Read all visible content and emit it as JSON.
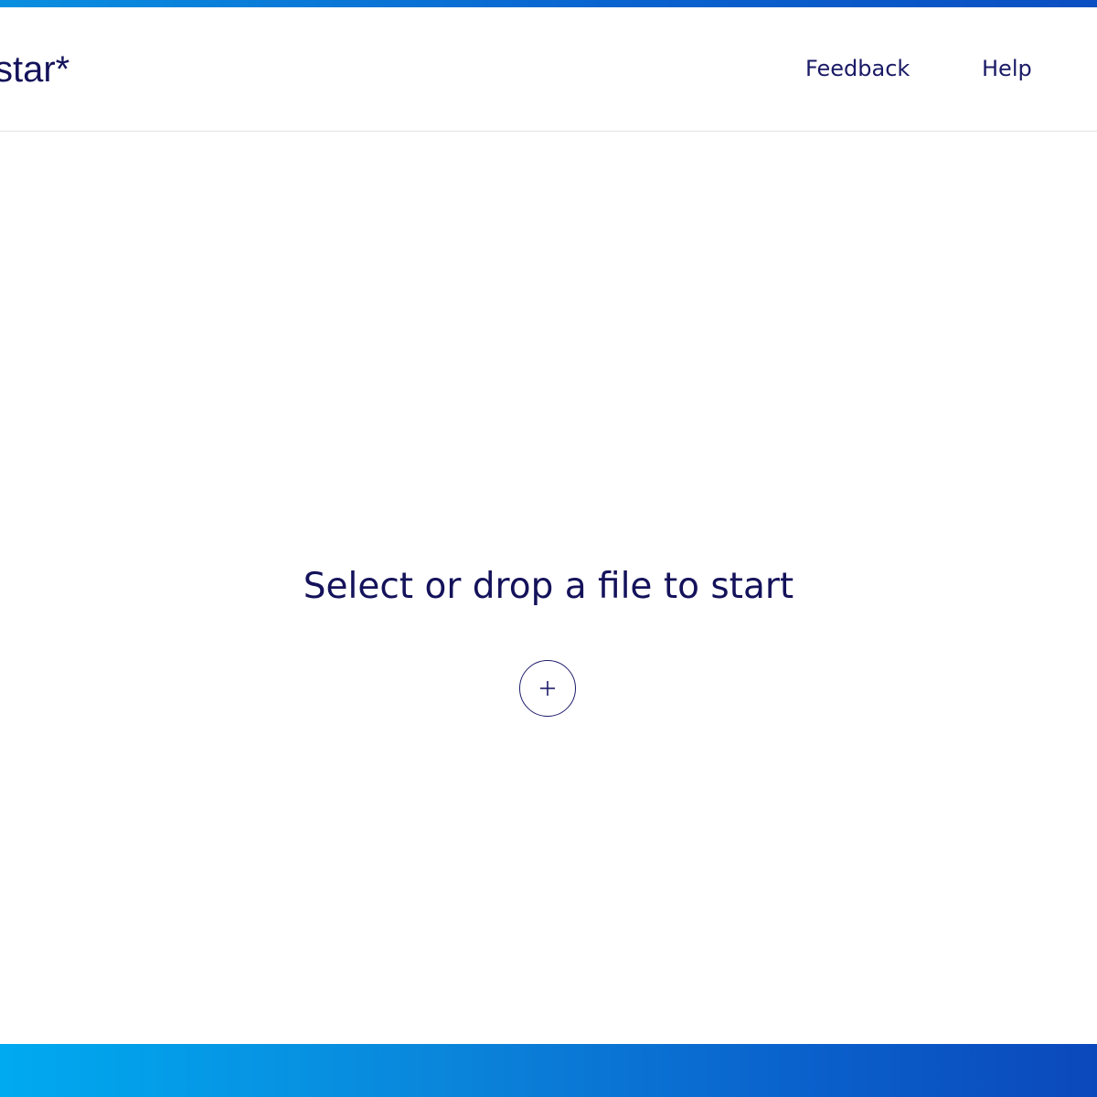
{
  "brand": {
    "logo_text": "star*"
  },
  "nav": {
    "feedback_label": "Feedback",
    "help_label": "Help"
  },
  "main": {
    "prompt_text": "Select or drop a file to start",
    "add_button_icon": "plus-icon"
  },
  "colors": {
    "text_primary": "#14125a",
    "accent_gradient_start": "#00aaf0",
    "accent_gradient_end": "#0b48bb",
    "background": "#ffffff"
  }
}
